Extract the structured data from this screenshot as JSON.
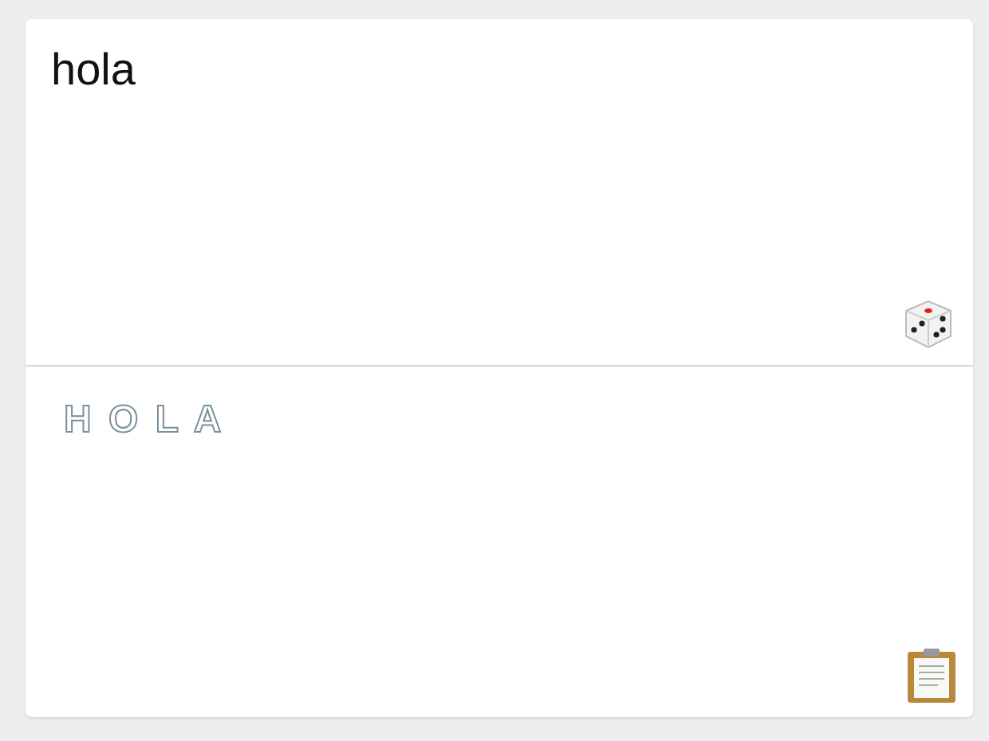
{
  "input": {
    "value": "hola"
  },
  "output": {
    "text": "H O L A"
  }
}
